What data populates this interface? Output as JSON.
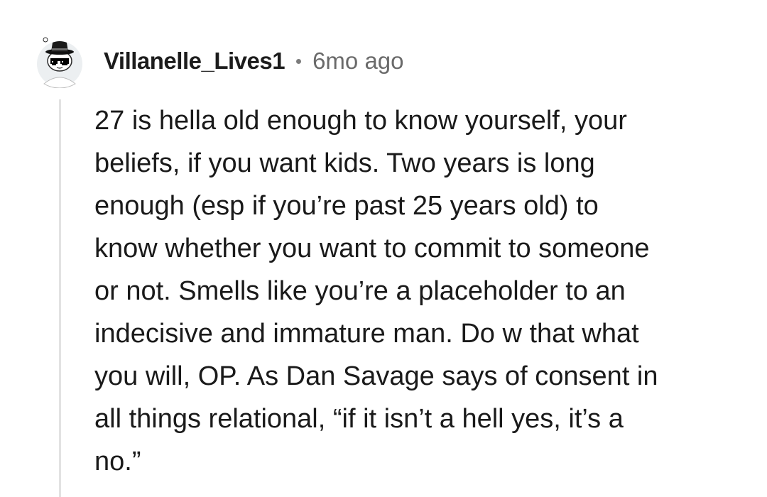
{
  "comment": {
    "username": "Villanelle_Lives1",
    "timestamp": "6mo ago",
    "body_lines": [
      "27 is hella old enough to know yourself, your",
      "beliefs, if you want kids. Two years is long",
      "enough (esp if you’re past 25 years old) to",
      "know whether you want to commit to someone",
      "or not. Smells like you’re a placeholder to an",
      "indecisive and immature man. Do w that what",
      "you will, OP. As Dan Savage says of consent in",
      "all things relational, “if it isn’t a hell yes, it’s a",
      "no.”"
    ]
  },
  "icons": {
    "avatar": "snoo-avatar-with-fedora-and-pixel-sunglasses",
    "separator": "dot-separator-icon"
  },
  "colors": {
    "username": "#1c1c1c",
    "timestamp": "#6a6a6a",
    "body_text": "#1a1a1a",
    "thread_line": "#e2e2e2",
    "background": "#ffffff"
  }
}
